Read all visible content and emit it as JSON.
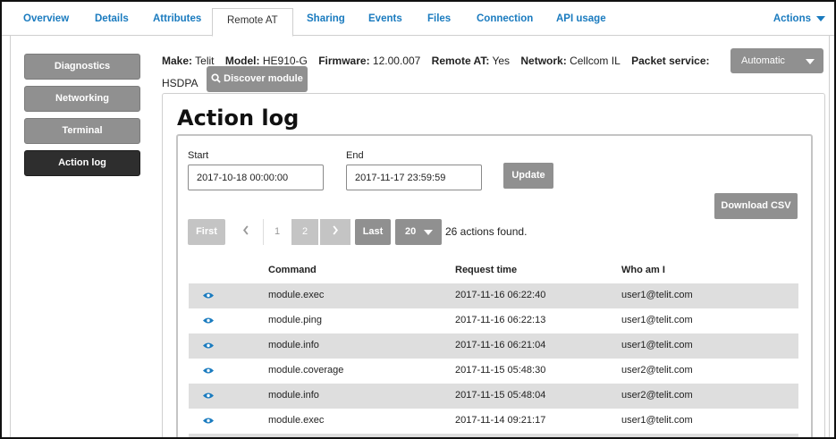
{
  "tabs": [
    {
      "label": "Overview"
    },
    {
      "label": "Details"
    },
    {
      "label": "Attributes"
    },
    {
      "label": "Remote AT"
    },
    {
      "label": "Sharing"
    },
    {
      "label": "Events"
    },
    {
      "label": "Files"
    },
    {
      "label": "Connection"
    },
    {
      "label": "API usage"
    }
  ],
  "actions_label": "Actions",
  "sidenav": [
    {
      "label": "Diagnostics"
    },
    {
      "label": "Networking"
    },
    {
      "label": "Terminal"
    },
    {
      "label": "Action log"
    }
  ],
  "info": {
    "make_label": "Make:",
    "make": "Telit",
    "model_label": "Model:",
    "model": "HE910-G",
    "firmware_label": "Firmware:",
    "firmware": "12.00.007",
    "remote_label": "Remote AT:",
    "remote": "Yes",
    "network_label": "Network:",
    "network": "Cellcom IL",
    "packet_label": "Packet service:",
    "packet": "HSDPA"
  },
  "discover_label": "Discover module",
  "mode_select": "Automatic",
  "panel_title": "Action log",
  "filters": {
    "start_label": "Start",
    "start_value": "2017-10-18 00:00:00",
    "end_label": "End",
    "end_value": "2017-11-17 23:59:59",
    "update_label": "Update",
    "download_label": "Download CSV"
  },
  "pager": {
    "first": "First",
    "page1": "1",
    "page2": "2",
    "last": "Last",
    "page_size": "20",
    "found": "26 actions found."
  },
  "table": {
    "headers": [
      "Command",
      "Request time",
      "Who am I"
    ],
    "rows": [
      {
        "command": "module.exec",
        "time": "2017-11-16 06:22:40",
        "who": "user1@telit.com"
      },
      {
        "command": "module.ping",
        "time": "2017-11-16 06:22:13",
        "who": "user1@telit.com"
      },
      {
        "command": "module.info",
        "time": "2017-11-16 06:21:04",
        "who": "user1@telit.com"
      },
      {
        "command": "module.coverage",
        "time": "2017-11-15 05:48:30",
        "who": "user2@telit.com"
      },
      {
        "command": "module.info",
        "time": "2017-11-15 05:48:04",
        "who": "user2@telit.com"
      },
      {
        "command": "module.exec",
        "time": "2017-11-14 09:21:17",
        "who": "user1@telit.com"
      }
    ]
  },
  "colors": {
    "accent": "#1a7bbf",
    "button_grey": "#909090",
    "active_nav": "#2e2e2e",
    "row_shade": "#dedede"
  },
  "icons": {
    "row_view": "eye-icon",
    "discover": "search-icon",
    "prev": "chevron-left-icon",
    "next": "chevron-right-icon"
  }
}
